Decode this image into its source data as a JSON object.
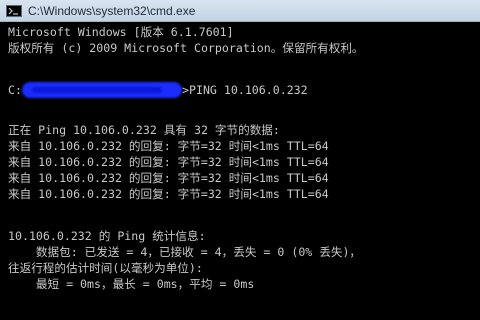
{
  "window": {
    "title": "C:\\Windows\\system32\\cmd.exe"
  },
  "console": {
    "lines": [
      "Microsoft Windows [版本 6.1.7601]",
      "版权所有 (c) 2009 Microsoft Corporation。保留所有权利。",
      "C:",
      "正在 Ping 10.106.0.232 具有 32 字节的数据:",
      "来自 10.106.0.232 的回复: 字节=32 时间<1ms TTL=64",
      "来自 10.106.0.232 的回复: 字节=32 时间<1ms TTL=64",
      "来自 10.106.0.232 的回复: 字节=32 时间<1ms TTL=64",
      "来自 10.106.0.232 的回复: 字节=32 时间<1ms TTL=64",
      "10.106.0.232 的 Ping 统计信息:",
      "    数据包: 已发送 = 4，已接收 = 4，丢失 = 0 (0% 丢失)，",
      "往返行程的估计时间(以毫秒为单位):",
      "    最短 = 0ms，最长 = 0ms，平均 = 0ms"
    ],
    "command": ">PING 10.106.0.232"
  },
  "colors": {
    "background": "#000000",
    "text": "#c8c8c8",
    "redaction": "#1a2cff"
  },
  "icons": {
    "titlebar": "cmd-icon"
  }
}
